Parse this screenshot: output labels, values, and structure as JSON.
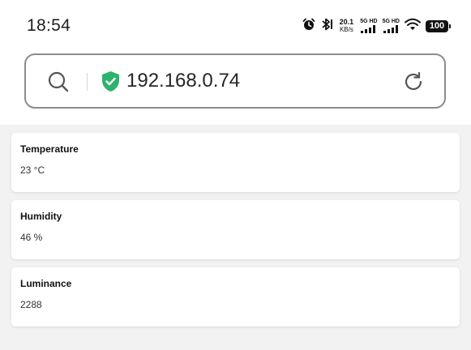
{
  "status_bar": {
    "time": "18:54",
    "net_speed_value": "20.1",
    "net_speed_unit": "KB/s",
    "signal1_label": "5G HD",
    "signal2_label": "5G HD",
    "battery": "100",
    "icons": [
      "alarm-icon",
      "bluetooth-icon",
      "signal-icon",
      "signal-icon",
      "wifi-icon",
      "battery-icon"
    ]
  },
  "address_bar": {
    "url": "192.168.0.74",
    "secure": true,
    "accent_color": "#2db36b"
  },
  "cards": [
    {
      "title": "Temperature",
      "value": "23 °C"
    },
    {
      "title": "Humidity",
      "value": "46 %"
    },
    {
      "title": "Luminance",
      "value": "2288"
    }
  ]
}
